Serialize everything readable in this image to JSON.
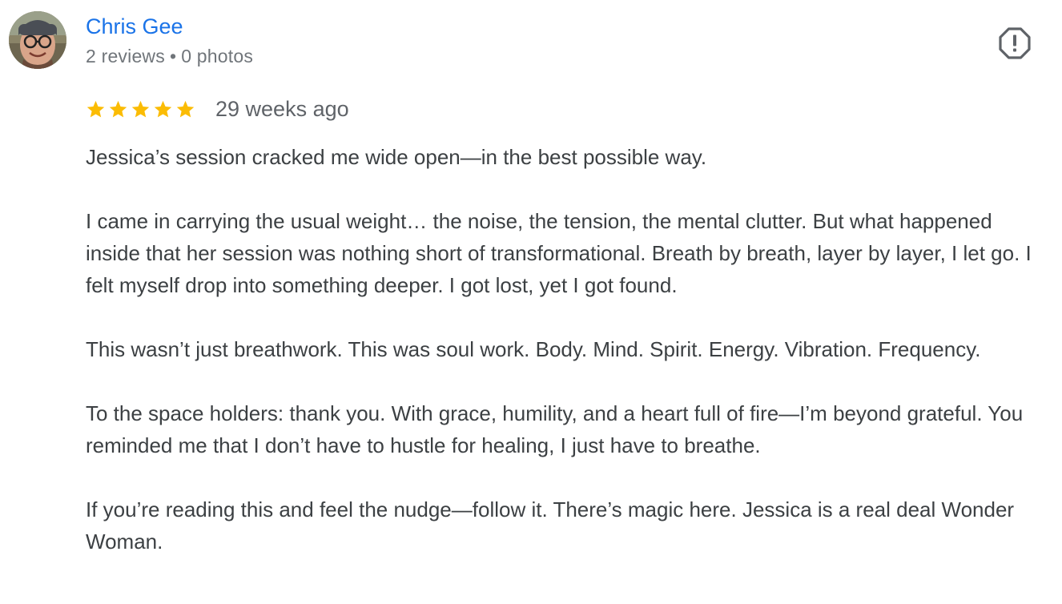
{
  "review": {
    "author": {
      "name": "Chris Gee",
      "reviews_count": "2 reviews",
      "separator": "•",
      "photos_count": "0 photos",
      "avatar_icon": "user-avatar-photo"
    },
    "report_icon": "flag-report-icon",
    "rating": {
      "stars": 5,
      "max": 5,
      "star_color": "#fbbc04"
    },
    "date": "29 weeks ago",
    "paragraphs": [
      "Jessica’s session cracked me wide open—in the best possible way.",
      "I came in carrying the usual weight… the noise, the tension, the mental clutter. But what happened inside that her session was nothing short of transformational. Breath by breath, layer by layer, I let go. I felt myself drop into something deeper. I got lost, yet I got found.",
      "This wasn’t just breathwork. This was soul work. Body. Mind. Spirit. Energy. Vibration. Frequency.",
      "To the space holders: thank you. With grace, humility, and a heart full of fire—I’m beyond grateful. You reminded me that I don’t have to hustle for healing, I just have to breathe.",
      "If you’re reading this and feel the nudge—follow it. There’s magic here. Jessica is a real deal Wonder Woman."
    ],
    "colors": {
      "name": "#1a73e8",
      "meta": "#70757a",
      "body": "#3c4043"
    }
  }
}
